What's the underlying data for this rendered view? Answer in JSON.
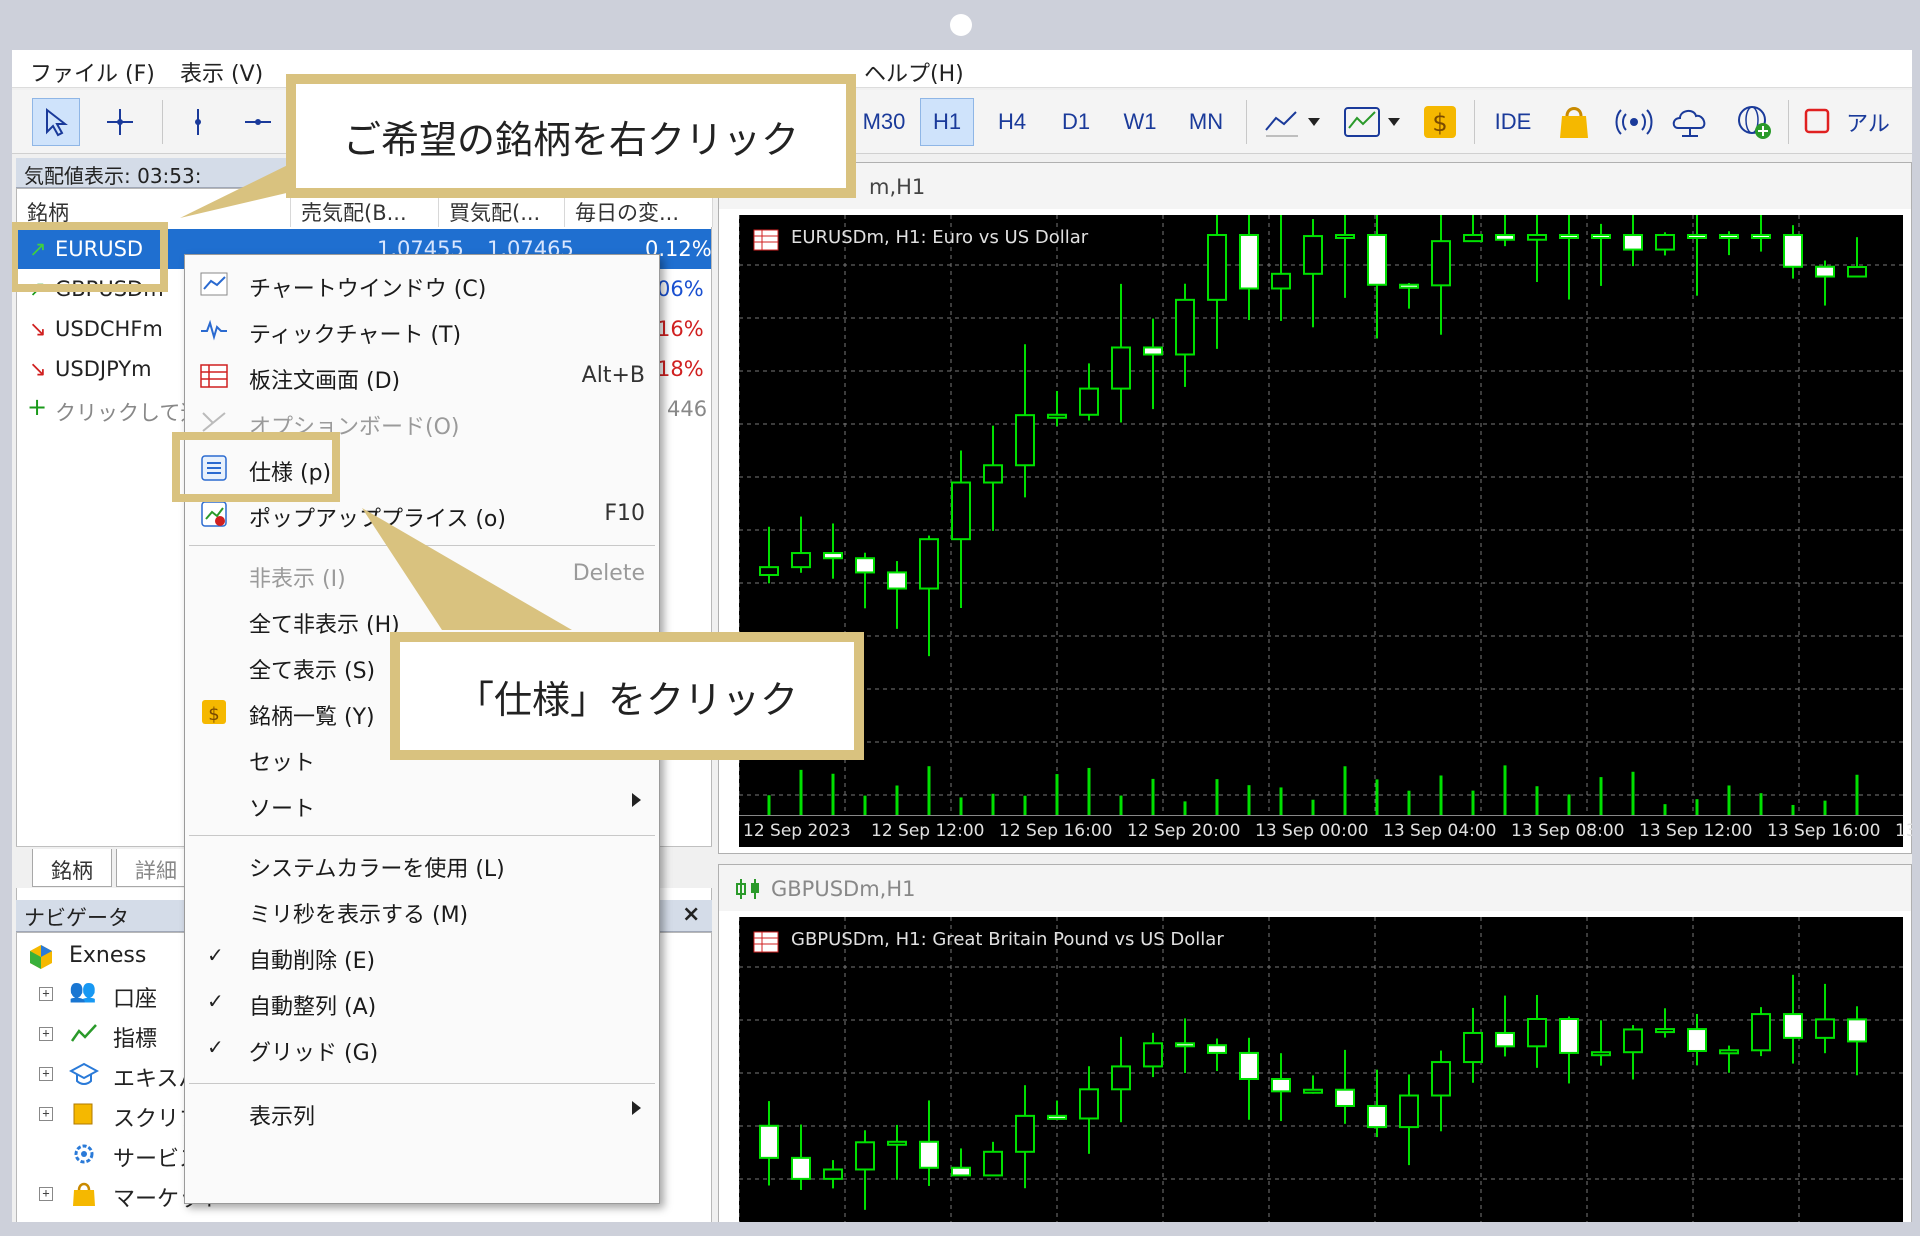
{
  "menu": {
    "file": "ファイル (F)",
    "view": "表示 (V)",
    "help": "ヘルプ(H)"
  },
  "toolbar": {
    "timeframes": [
      "M30",
      "H1",
      "H4",
      "D1",
      "W1",
      "MN"
    ],
    "active_timeframe": "H1",
    "ide": "IDE",
    "algo": "アル"
  },
  "market_watch": {
    "title": "気配値表示: 03:53:",
    "columns": [
      "銘柄",
      "売気配(B...",
      "買気配(...",
      "毎日の変..."
    ],
    "rows": [
      {
        "symbol": "EURUSD",
        "bid": "1.07455",
        "ask": "1.07465",
        "change": "0.12%",
        "dir": "up"
      },
      {
        "symbol": "GBPUSDm",
        "change": "06%",
        "dir": "up"
      },
      {
        "symbol": "USDCHFm",
        "change": "16%",
        "dir": "down"
      },
      {
        "symbol": "USDJPYm",
        "change": "18%",
        "dir": "down"
      }
    ],
    "add_row": "クリックして追",
    "add_count": "446",
    "tabs": [
      "銘柄",
      "詳細"
    ]
  },
  "navigator": {
    "title": "ナビゲータ",
    "close": "×",
    "items": [
      "Exness",
      "口座",
      "指標",
      "エキスパ",
      "スクリプ",
      "サービス",
      "マーケット"
    ]
  },
  "context_menu": {
    "items": [
      {
        "label": "チャートウインドウ (C)",
        "shortcut": ""
      },
      {
        "label": "ティックチャート (T)",
        "shortcut": ""
      },
      {
        "label": "板注文画面 (D)",
        "shortcut": "Alt+B"
      },
      {
        "label": "オプションボード(O)",
        "shortcut": ""
      },
      {
        "label": "仕様 (p)",
        "shortcut": ""
      },
      {
        "label": "ポップアッププライス (o)",
        "shortcut": "F10"
      },
      {
        "label": "非表示 (I)",
        "shortcut": "Delete"
      },
      {
        "label": "全て非表示 (H)",
        "shortcut": ""
      },
      {
        "label": "全て表示 (S)",
        "shortcut": ""
      },
      {
        "label": "銘柄一覧 (Y)",
        "shortcut": ""
      },
      {
        "label": "セット",
        "shortcut": ""
      },
      {
        "label": "ソート",
        "shortcut": ""
      },
      {
        "label": "システムカラーを使用 (L)",
        "shortcut": ""
      },
      {
        "label": "ミリ秒を表示する (M)",
        "shortcut": ""
      },
      {
        "label": "自動削除 (E)",
        "shortcut": ""
      },
      {
        "label": "自動整列 (A)",
        "shortcut": ""
      },
      {
        "label": "グリッド (G)",
        "shortcut": ""
      },
      {
        "label": "表示列",
        "shortcut": ""
      }
    ],
    "check_mark": "✓"
  },
  "chart1": {
    "window_title": "m,H1",
    "label": "EURUSDm, H1:  Euro vs US Dollar",
    "x_labels": [
      "12 Sep 2023",
      "12 Sep 12:00",
      "12 Sep 16:00",
      "12 Sep 20:00",
      "13 Sep 00:00",
      "13 Sep 04:00",
      "13 Sep 08:00",
      "13 Sep 12:00",
      "13 Sep 16:00",
      "13"
    ]
  },
  "chart2": {
    "window_title": "GBPUSDm,H1",
    "label": "GBPUSDm, H1:  Great Britain Pound vs US Dollar"
  },
  "callouts": {
    "right_click": "ご希望の銘柄を右クリック",
    "click_spec": "「仕様」をクリック"
  },
  "colors": {
    "highlight": "#d9c27f",
    "selection": "#1f6fd0",
    "candle_line": "#00ff00",
    "chart_bg": "#000000"
  }
}
